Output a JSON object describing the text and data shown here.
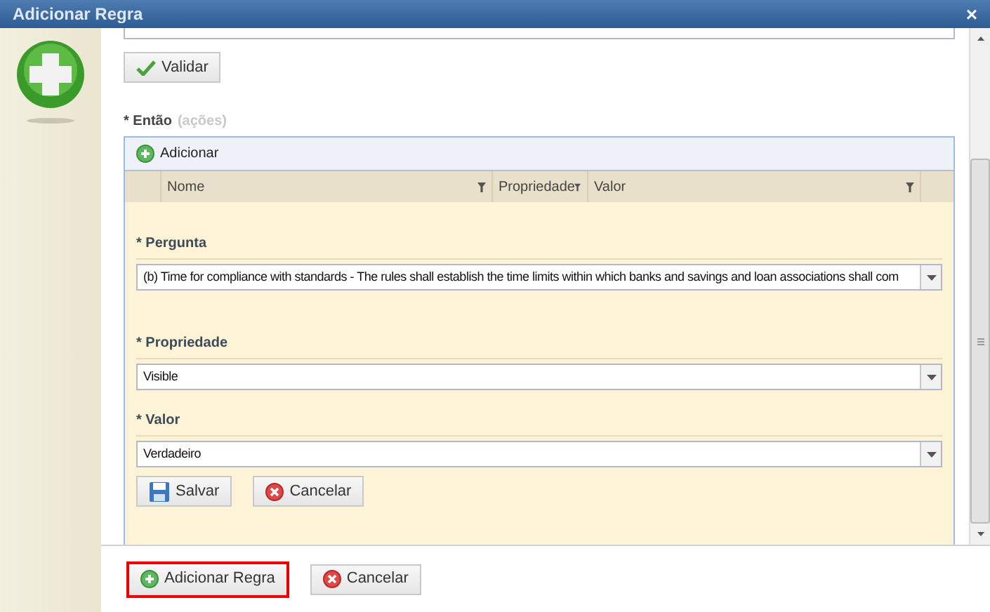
{
  "window": {
    "title": "Adicionar Regra",
    "close": "×"
  },
  "validate_button": "Validar",
  "actions": {
    "label": "* Então",
    "hint": "(ações)",
    "toolbar_button": "Adicionar",
    "columns": [
      "Nome",
      "Propriedade",
      "Valor"
    ],
    "fields": [
      {
        "label": "* Pergunta",
        "value": "(b) Time for compliance with standards - The rules shall establish the time limits within which banks and savings and loan associations shall com"
      },
      {
        "label": "* Propriedade",
        "value": "Visible"
      },
      {
        "label": "* Valor",
        "value": "Verdadeiro"
      }
    ],
    "editor_buttons": [
      {
        "kind": "save",
        "label": "Salvar"
      },
      {
        "kind": "cancel",
        "label": "Cancelar"
      }
    ]
  },
  "footer_buttons": [
    {
      "kind": "add",
      "label": "Adicionar Regra",
      "highlighted": true
    },
    {
      "kind": "cancel",
      "label": "Cancelar",
      "highlighted": false
    }
  ]
}
